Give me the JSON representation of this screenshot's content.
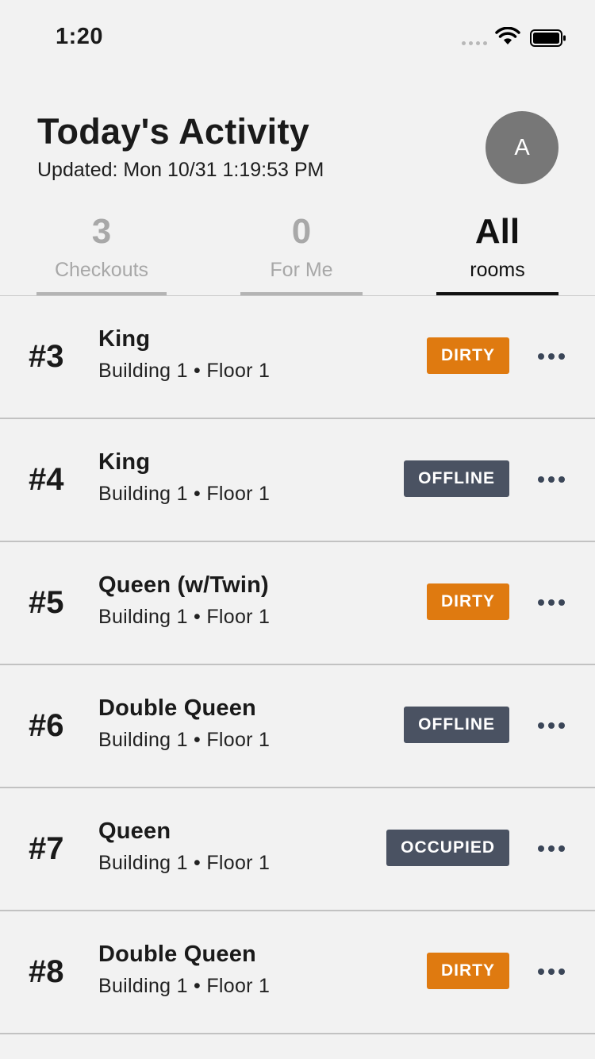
{
  "status_bar": {
    "time": "1:20"
  },
  "header": {
    "title": "Today's Activity",
    "updated": "Updated: Mon 10/31 1:19:53 PM",
    "avatar_initial": "A"
  },
  "tabs": [
    {
      "count": "3",
      "label": "Checkouts",
      "active": false
    },
    {
      "count": "0",
      "label": "For Me",
      "active": false
    },
    {
      "count": "All",
      "label": "rooms",
      "active": true
    }
  ],
  "status_colors": {
    "DIRTY": "#df7a10",
    "OFFLINE": "#4a5262",
    "OCCUPIED": "#4a5262"
  },
  "rooms": [
    {
      "number": "#3",
      "type": "King",
      "location": "Building 1 • Floor 1",
      "status": "DIRTY"
    },
    {
      "number": "#4",
      "type": "King",
      "location": "Building 1 • Floor 1",
      "status": "OFFLINE"
    },
    {
      "number": "#5",
      "type": "Queen (w/Twin)",
      "location": "Building 1 • Floor 1",
      "status": "DIRTY"
    },
    {
      "number": "#6",
      "type": "Double Queen",
      "location": "Building 1 • Floor 1",
      "status": "OFFLINE"
    },
    {
      "number": "#7",
      "type": "Queen",
      "location": "Building 1 • Floor 1",
      "status": "OCCUPIED"
    },
    {
      "number": "#8",
      "type": "Double Queen",
      "location": "Building 1 • Floor 1",
      "status": "DIRTY"
    }
  ]
}
